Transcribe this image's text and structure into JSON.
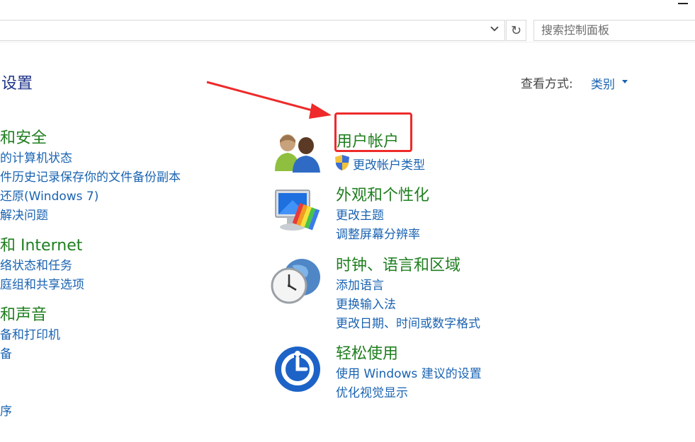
{
  "address_bar": {
    "refresh_symbol": "↻",
    "search_placeholder": "搜索控制面板"
  },
  "header": {
    "title": "设置",
    "view_by_label": "查看方式:",
    "view_by_value": "类别"
  },
  "left_column": {
    "categories": [
      {
        "title": "和安全",
        "links": [
          "的计算机状态",
          "件历史记录保存你的文件备份副本",
          "还原(Windows 7)",
          "解决问题"
        ]
      },
      {
        "title": "和 Internet",
        "links": [
          "络状态和任务",
          "庭组和共享选项"
        ]
      },
      {
        "title": "和声音",
        "links": [
          "备和打印机",
          "备"
        ]
      },
      {
        "title": "",
        "links": [
          "序"
        ]
      }
    ]
  },
  "right_column": {
    "categories": [
      {
        "title": "用户帐户",
        "links": [
          "更改帐户类型"
        ],
        "icon": "users-icon"
      },
      {
        "title": "外观和个性化",
        "links": [
          "更改主题",
          "调整屏幕分辨率"
        ],
        "icon": "display-palette-icon"
      },
      {
        "title": "时钟、语言和区域",
        "links": [
          "添加语言",
          "更换输入法",
          "更改日期、时间或数字格式"
        ],
        "icon": "globe-clock-icon"
      },
      {
        "title": "轻松使用",
        "links": [
          "使用 Windows 建议的设置",
          "优化视觉显示"
        ],
        "icon": "ease-of-access-icon"
      }
    ]
  },
  "annotation": {
    "arrow_color": "#ee2a2a",
    "box_color": "#ee2a2a"
  }
}
